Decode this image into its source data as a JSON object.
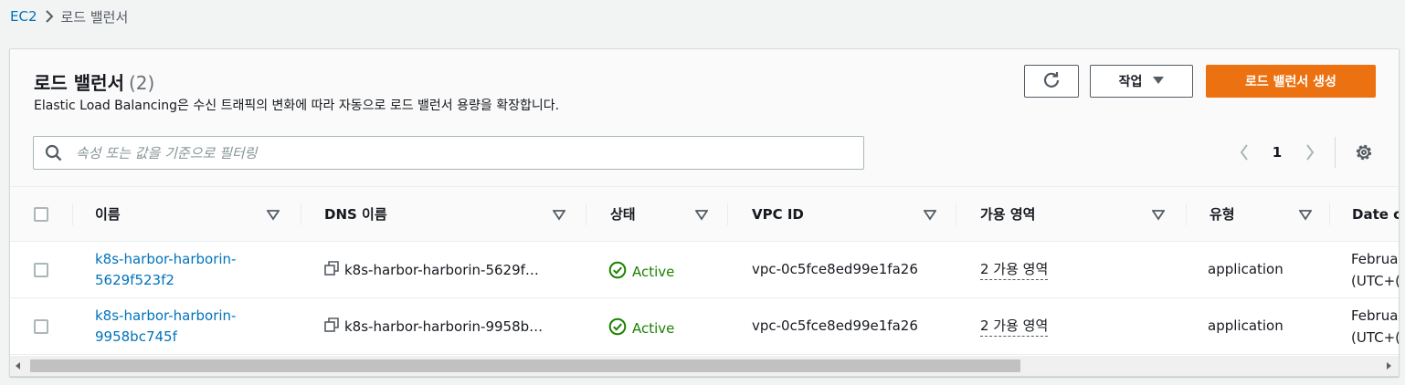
{
  "breadcrumb": {
    "root": "EC2",
    "current": "로드 밸런서"
  },
  "header": {
    "title": "로드 밸런서",
    "count": "(2)",
    "description": "Elastic Load Balancing은 수신 트래픽의 변화에 따라 자동으로 로드 밸런서 용량을 확장합니다.",
    "action_label": "작업",
    "create_label": "로드 밸런서 생성"
  },
  "search": {
    "placeholder": "속성 또는 값을 기준으로 필터링"
  },
  "pagination": {
    "current_page": "1"
  },
  "columns": [
    "이름",
    "DNS 이름",
    "상태",
    "VPC ID",
    "가용 영역",
    "유형",
    "Date c"
  ],
  "rows": [
    {
      "name_line1": "k8s-harbor-harborin-",
      "name_line2": "5629f523f2",
      "dns": "k8s-harbor-harborin-5629f…",
      "status": "Active",
      "vpc": "vpc-0c5fce8ed99e1fa26",
      "az": "2 가용 영역",
      "type": "application",
      "date_line1": "Februa",
      "date_line2": "(UTC+("
    },
    {
      "name_line1": "k8s-harbor-harborin-",
      "name_line2": "9958bc745f",
      "dns": "k8s-harbor-harborin-9958b…",
      "status": "Active",
      "vpc": "vpc-0c5fce8ed99e1fa26",
      "az": "2 가용 영역",
      "type": "application",
      "date_line1": "Februa",
      "date_line2": "(UTC+("
    }
  ],
  "colors": {
    "accent": "#ec7211",
    "link": "#0073bb",
    "success": "#1d8102"
  },
  "icons": [
    "chevron-right-icon",
    "refresh-icon",
    "caret-down-icon",
    "search-icon",
    "chevron-left-icon",
    "gear-icon",
    "sort-caret-icon",
    "copy-icon",
    "check-circle-icon",
    "scroll-left-icon",
    "scroll-right-icon"
  ]
}
